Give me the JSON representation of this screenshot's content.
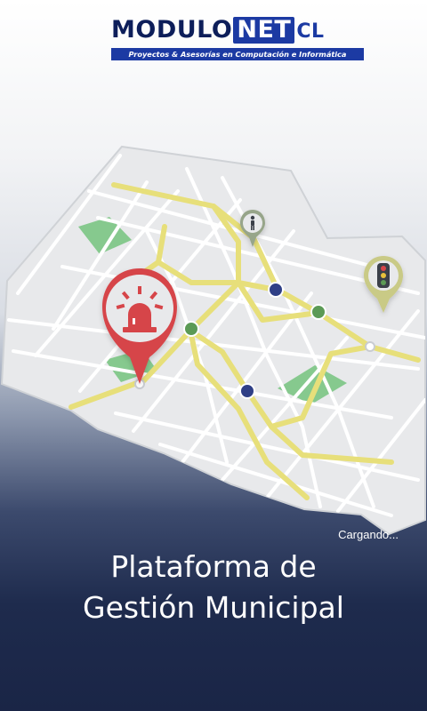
{
  "brand": {
    "name_part1": "MODULO",
    "name_part2": "NET",
    "name_part3": "CL",
    "tagline": "Proyectos & Asesorías en Computación e Informática"
  },
  "loading": {
    "status_text": "Cargando..."
  },
  "headline": {
    "line1": "Plataforma de",
    "line2": "Gestión Municipal"
  },
  "map": {
    "icons": [
      "siren-icon",
      "pedestrian-icon",
      "traffic-light-icon"
    ]
  },
  "colors": {
    "brand_blue": "#1c3aa3",
    "brand_navy": "#0d1e5a",
    "map_surface": "#e8e9eb",
    "road_yellow": "#e7df7a",
    "park_green": "#86c98e",
    "pin_red": "#d6454a"
  }
}
